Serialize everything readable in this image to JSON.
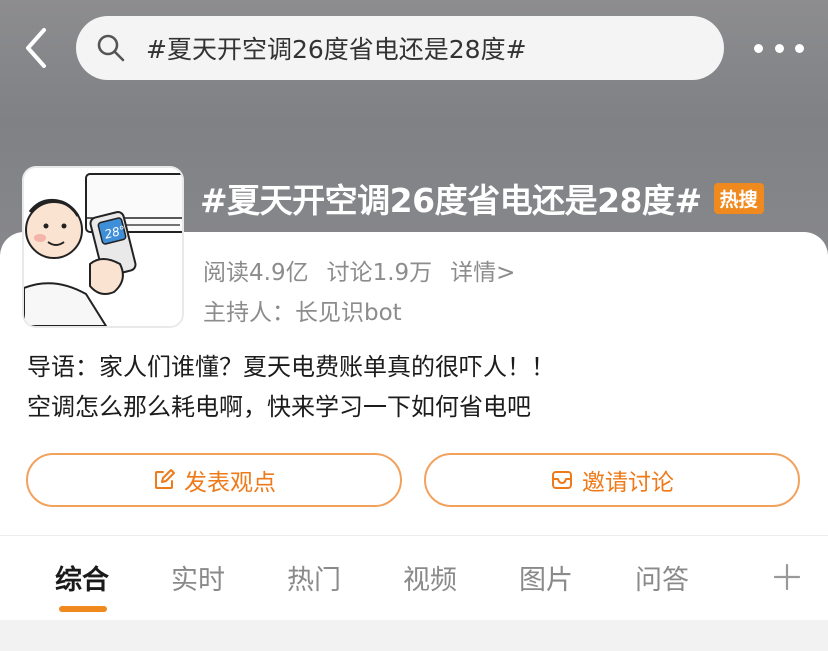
{
  "header": {
    "back_icon": "chevron-left-icon",
    "search_icon": "search-icon",
    "search_text": "#夏天开空调26度省电还是28度#",
    "more_icon": "more-dots-icon"
  },
  "topic": {
    "thumbnail": "air-conditioner-remote-illustration",
    "thumbnail_display": "28°",
    "title": "#夏天开空调26度省电还是28度#",
    "badge": "热搜",
    "reads": "阅读4.9亿",
    "discussions": "讨论1.9万",
    "detail_link": "详情>",
    "host": "主持人：长见识bot",
    "intro_line1": "导语：家人们谁懂？夏天电费账单真的很吓人！！",
    "intro_line2": "空调怎么那么耗电啊，快来学习一下如何省电吧"
  },
  "actions": {
    "post_label": "发表观点",
    "post_icon": "edit-icon",
    "invite_label": "邀请讨论",
    "invite_icon": "mail-icon"
  },
  "tabs": [
    "综合",
    "实时",
    "热门",
    "视频",
    "图片",
    "问答"
  ],
  "tabs_add_icon": "plus-icon",
  "colors": {
    "accent": "#F08A1E",
    "button_border": "#F2A25C",
    "button_text": "#EE7A1A",
    "muted_text": "#8C8C8C",
    "hero_bg": "#8D8D8F"
  }
}
